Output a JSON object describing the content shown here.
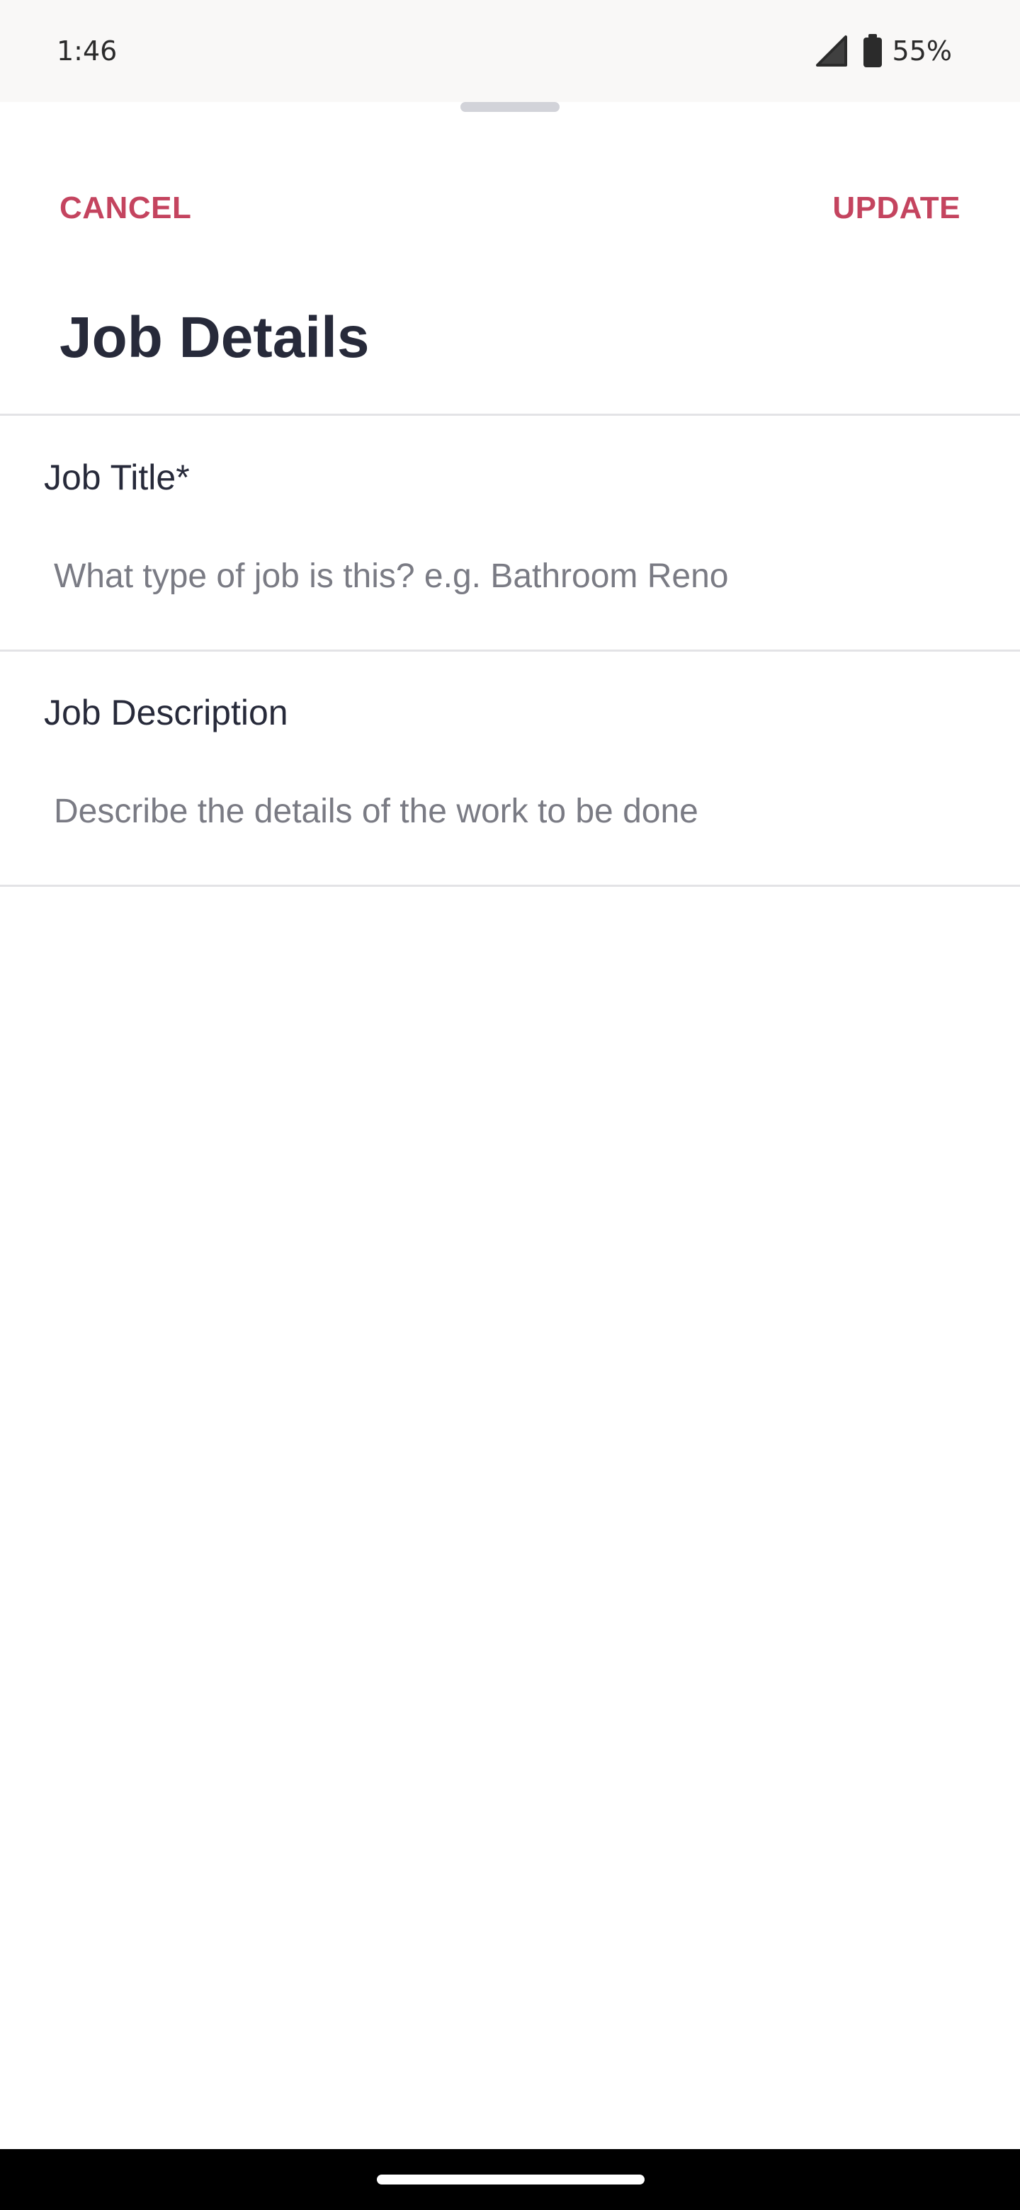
{
  "status_bar": {
    "time": "1:46",
    "battery_percent": "55%",
    "icons": [
      "signal-icon",
      "battery-icon"
    ]
  },
  "header": {
    "cancel_label": "CANCEL",
    "update_label": "UPDATE",
    "title": "Job Details"
  },
  "form": {
    "job_title": {
      "label": "Job Title*",
      "value": "",
      "placeholder": "What type of job is this? e.g. Bathroom Reno"
    },
    "job_description": {
      "label": "Job Description",
      "value": "",
      "placeholder": "Describe the details of the work to be done"
    }
  },
  "colors": {
    "accent": "#c4445f",
    "title_text": "#272a3a",
    "placeholder": "#7a7b84",
    "divider": "#e3e3e6",
    "status_bar_bg": "#f9f8f7"
  }
}
